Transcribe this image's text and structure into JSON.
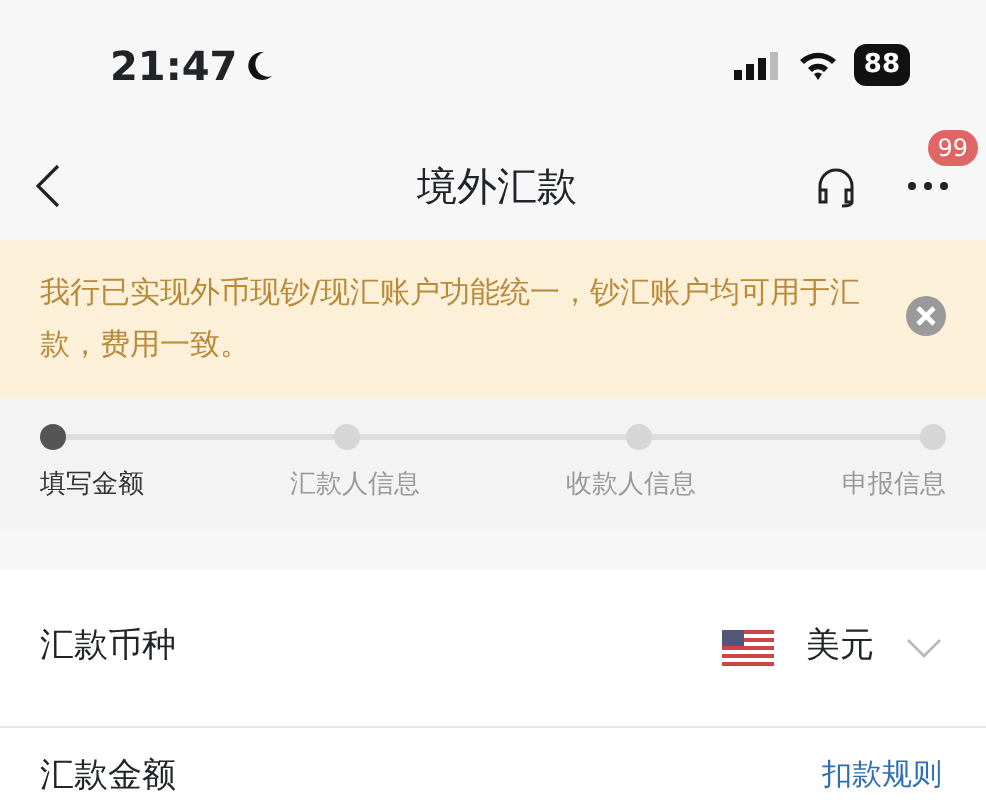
{
  "status_bar": {
    "time": "21:47",
    "battery": "88"
  },
  "nav": {
    "title": "境外汇款",
    "badge": "99"
  },
  "notice": {
    "text": "我行已实现外币现钞/现汇账户功能统一，钞汇账户均可用于汇款，费用一致。"
  },
  "steps": [
    {
      "label": "填写金额",
      "selected": true
    },
    {
      "label": "汇款人信息",
      "selected": false
    },
    {
      "label": "收款人信息",
      "selected": false
    },
    {
      "label": "申报信息",
      "selected": false
    }
  ],
  "currency": {
    "label": "汇款币种",
    "value": "美元"
  },
  "amount": {
    "label": "汇款金额",
    "link": "扣款规则"
  }
}
